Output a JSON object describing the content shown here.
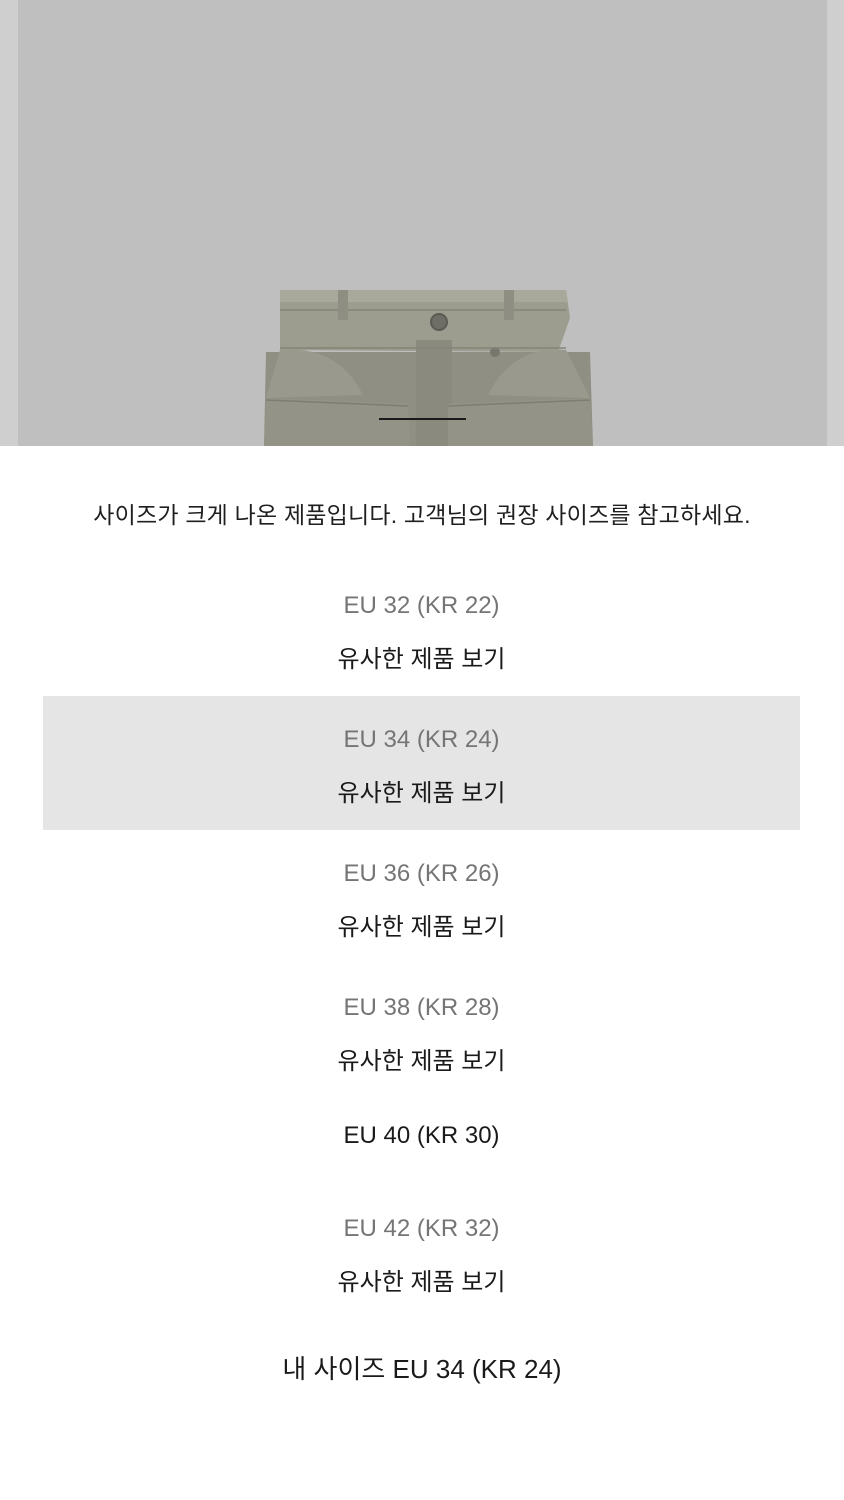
{
  "product_image": {
    "alt": ""
  },
  "notice": "사이즈가 크게 나온 제품입니다. 고객님의 권장 사이즈를 참고하세요.",
  "sizes": [
    {
      "label": "EU 32 (KR 22)",
      "link": "유사한 제품 보기",
      "selected": false
    },
    {
      "label": "EU 34 (KR 24)",
      "link": "유사한 제품 보기",
      "selected": true
    },
    {
      "label": "EU 36 (KR 26)",
      "link": "유사한 제품 보기",
      "selected": false
    },
    {
      "label": "EU 38 (KR 28)",
      "link": "유사한 제품 보기",
      "selected": false
    },
    {
      "label": "EU 40 (KR 30)",
      "link": "",
      "selected": false
    },
    {
      "label": "EU 42 (KR 32)",
      "link": "유사한 제품 보기",
      "selected": false
    }
  ],
  "my_size": "내 사이즈 EU 34 (KR 24)",
  "colors": {
    "selected_row": "#e5e5e5",
    "unavailable_text": "#757575",
    "available_text": "#1a1a1a"
  }
}
